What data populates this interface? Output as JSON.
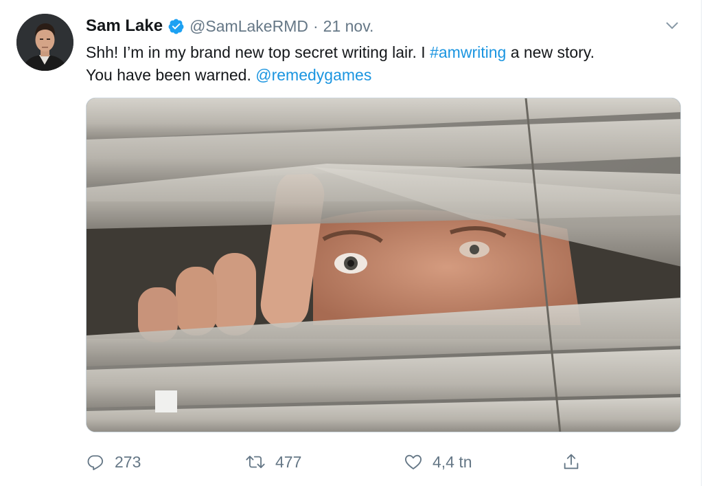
{
  "author": {
    "display_name": "Sam Lake",
    "handle": "@SamLakeRMD",
    "separator": "·",
    "date": "21 nov.",
    "verified": true
  },
  "tweet": {
    "line1_before": "Shh! I’m in my brand new top secret writing lair. I ",
    "hashtag": "#amwriting",
    "line1_after": " a new story.",
    "line2_before": "You have been warned. ",
    "mention": "@remedygames"
  },
  "actions": {
    "reply_count": "273",
    "retweet_count": "477",
    "like_count": "4,4 tn"
  },
  "icons": {
    "verified": "verified-badge-icon",
    "caret": "chevron-down-icon",
    "reply": "reply-icon",
    "retweet": "retweet-icon",
    "like": "heart-icon",
    "share": "share-icon"
  },
  "colors": {
    "link": "#1b95e0",
    "verified": "#1da1f2",
    "muted": "#657786",
    "text": "#14171a"
  }
}
